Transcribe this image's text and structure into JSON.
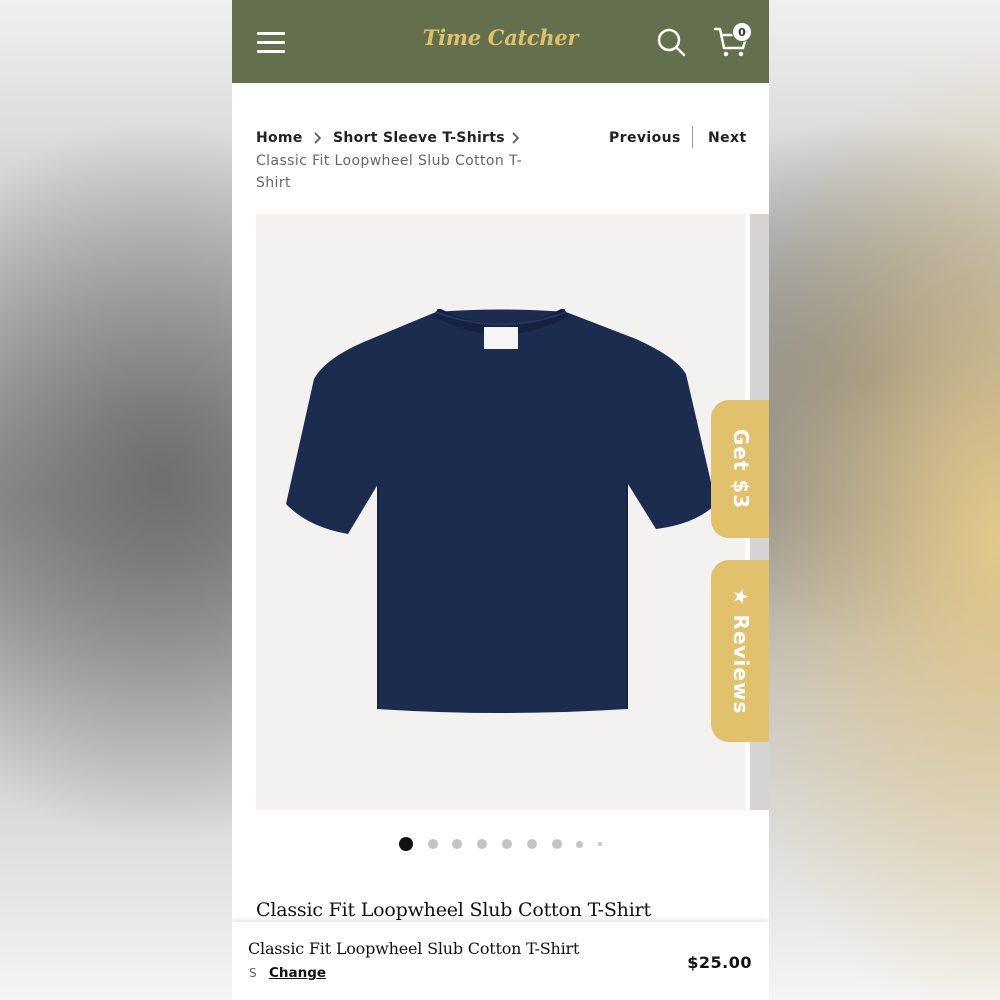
{
  "header": {
    "logo_text": "Time Catcher",
    "cart_count": "0",
    "background_color": "#64704d",
    "logo_color": "#dcc06a",
    "icons": [
      "menu-icon",
      "search-icon",
      "cart-icon"
    ]
  },
  "breadcrumb": {
    "items": [
      "Home",
      "Short Sleeve T-Shirts"
    ],
    "current": "Classic Fit Loopwheel Slub Cotton T-Shirt",
    "separator_icon": "chevron-right-icon"
  },
  "pagination": {
    "previous_label": "Previous",
    "next_label": "Next"
  },
  "gallery": {
    "image_name": "navy-tshirt",
    "shirt_color": "#1c2c4e",
    "dot_count": 9,
    "active_dot": 0
  },
  "side_tabs": {
    "reward_label": "Get $3",
    "reviews_label": "Reviews",
    "reviews_icon": "star-icon",
    "color": "#e2c16c"
  },
  "product": {
    "title": "Classic Fit Loopwheel Slub Cotton T-Shirt"
  },
  "sticky_bar": {
    "title": "Classic Fit Loopwheel Slub Cotton T-Shirt",
    "size": "S",
    "change_label": "Change",
    "price": "$25.00"
  }
}
